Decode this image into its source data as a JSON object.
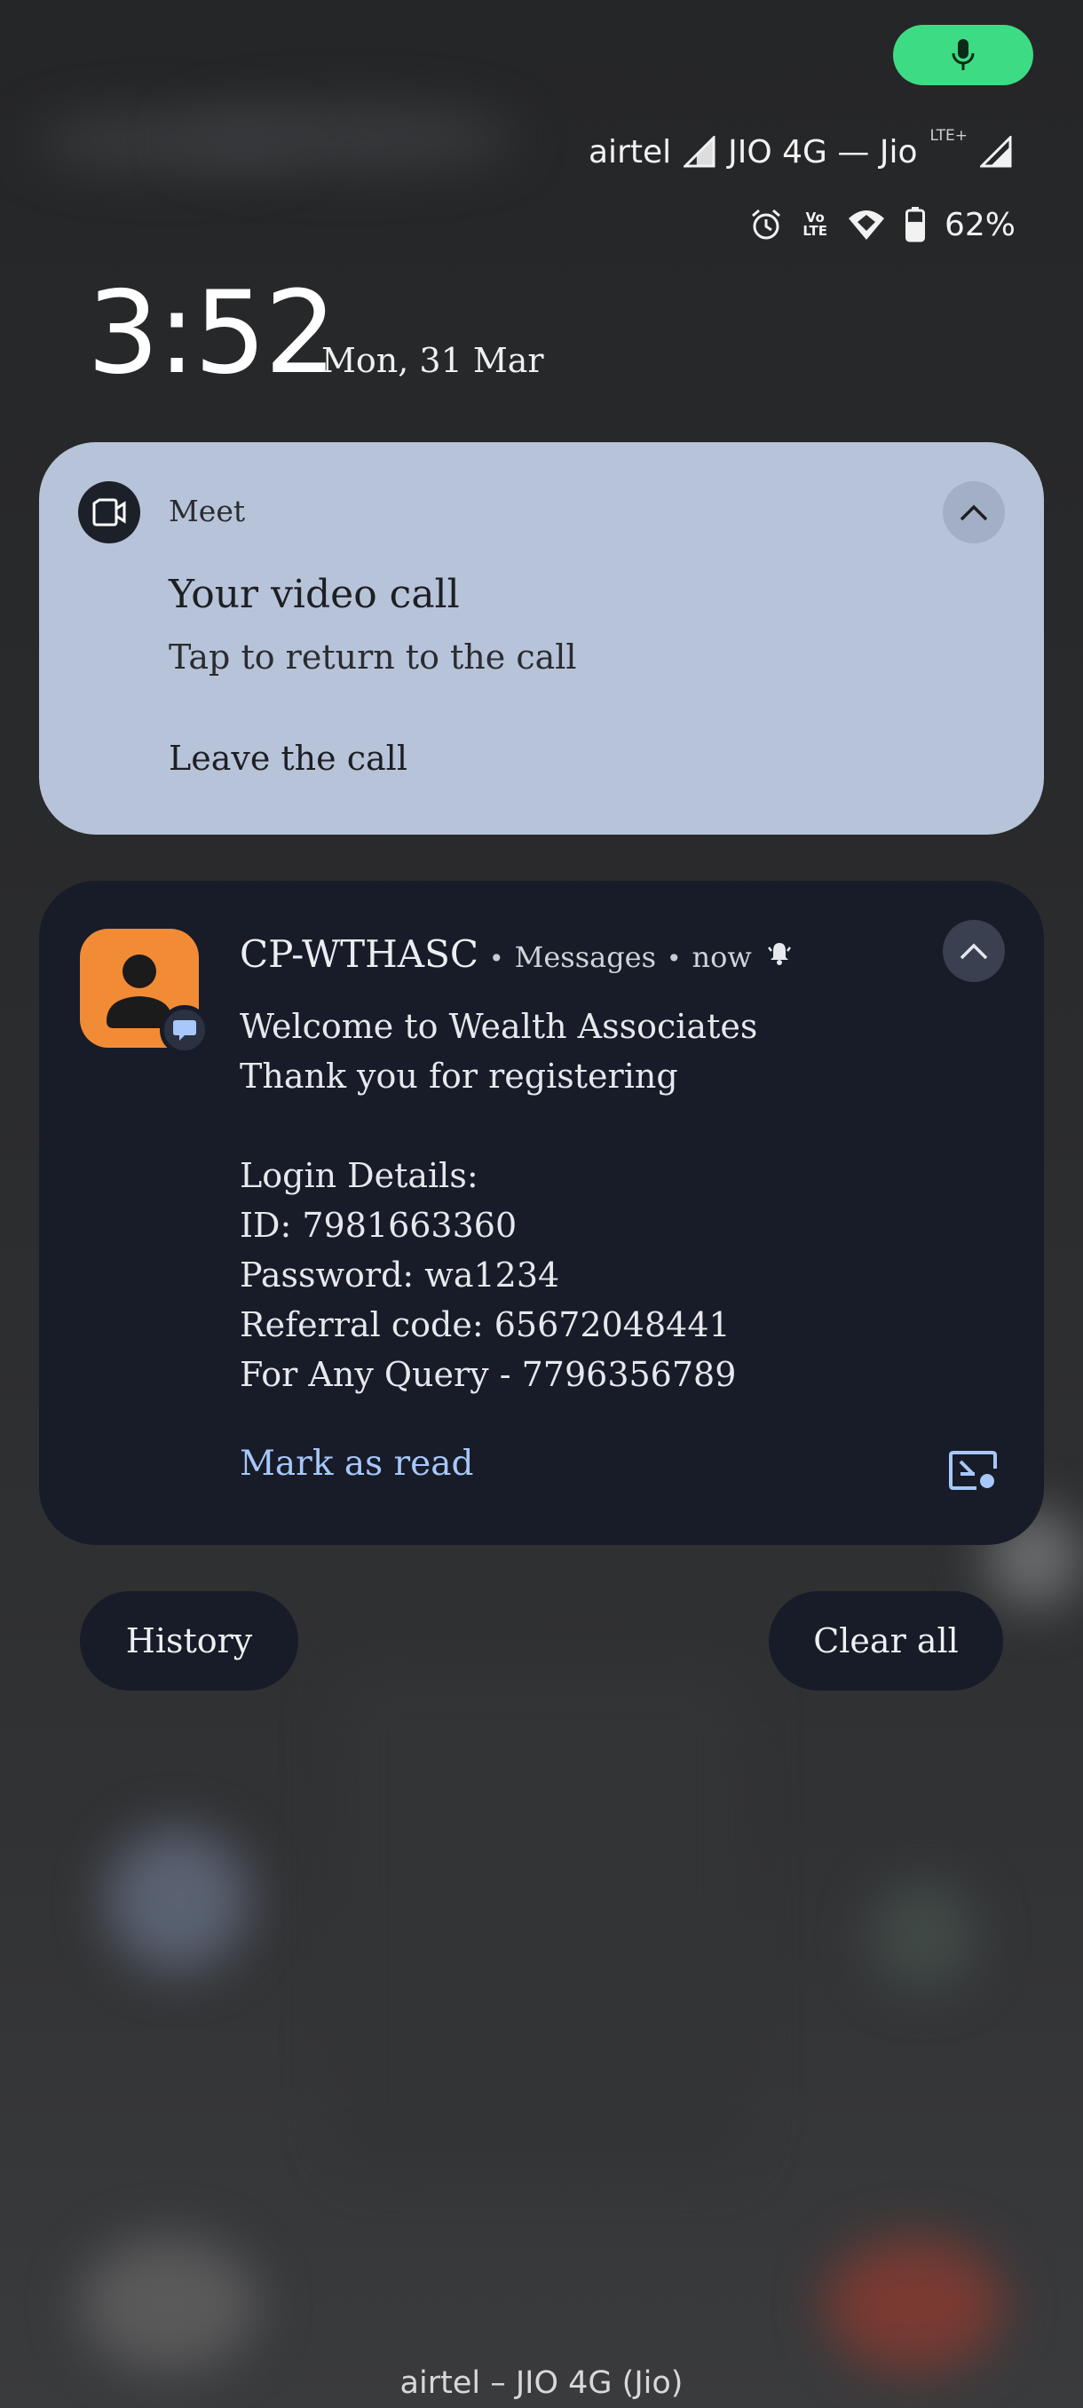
{
  "status_bar": {
    "carrier1": "airtel",
    "carrier2": "JIO 4G — Jio",
    "lte_plus": "LTE+",
    "volte_top": "Vo",
    "volte_bottom": "LTE",
    "battery": "62%",
    "battery_level": 0.62
  },
  "lockscreen": {
    "time": "3:52",
    "date": "Mon, 31 Mar"
  },
  "meet_notification": {
    "app_name": "Meet",
    "title": "Your video call",
    "subtitle": "Tap to return to the call",
    "action": "Leave the call",
    "card_color": "#b7c3d8"
  },
  "message_notification": {
    "sender": "CP-WTHASC",
    "app": "Messages",
    "time": "now",
    "body_lines": [
      "Welcome to Wealth Associates",
      "Thank you for registering",
      "",
      "Login Details:",
      "ID: 7981663360",
      "Password: wa1234",
      "Referral code: 65672048441",
      "For Any Query - 7796356789"
    ],
    "action": "Mark as read",
    "avatar_color": "#f28b36",
    "card_color": "#171c28",
    "link_color": "#a8c7fa"
  },
  "buttons": {
    "history": "History",
    "clear_all": "Clear all"
  },
  "footer": {
    "carrier_text": "airtel – JIO 4G (Jio)"
  },
  "colors": {
    "mic_pill": "#3ddc84"
  }
}
